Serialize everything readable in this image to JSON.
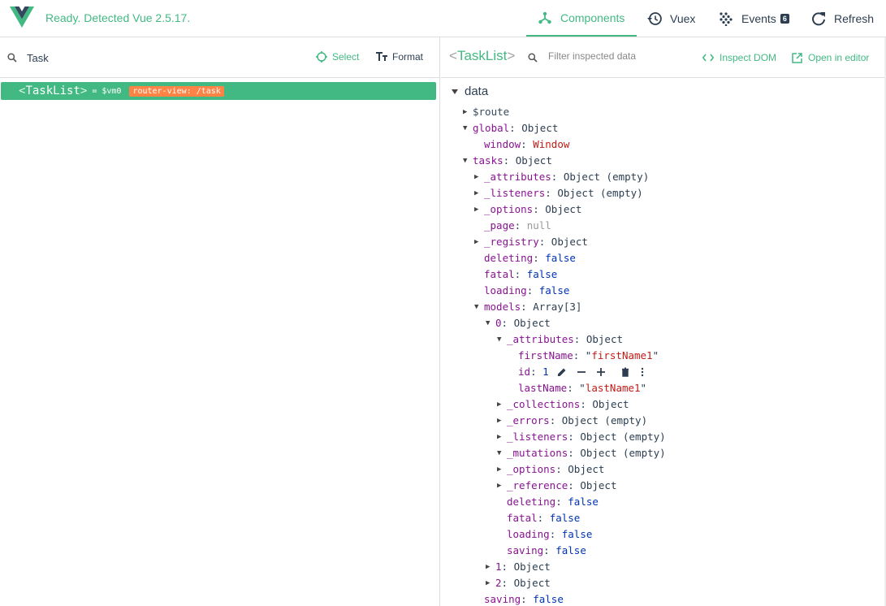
{
  "header": {
    "status": "Ready. Detected Vue 2.5.17.",
    "nav": [
      {
        "label": "Components",
        "icon": "components-icon",
        "active": true
      },
      {
        "label": "Vuex",
        "icon": "history-icon"
      },
      {
        "label": "Events",
        "icon": "events-icon",
        "badge": "6"
      },
      {
        "label": "Refresh",
        "icon": "refresh-icon"
      }
    ]
  },
  "left": {
    "search_value": "Task",
    "select_label": "Select",
    "format_label": "Format",
    "tree": {
      "open": "<",
      "name": "TaskList",
      "close": ">",
      "vm": "= $vm0",
      "route": "router-view: /task"
    }
  },
  "right": {
    "inspected": {
      "open": "<",
      "name": "TaskList",
      "close": ">"
    },
    "filter_placeholder": "Filter inspected data",
    "inspect_dom": "Inspect DOM",
    "open_editor": "Open in editor",
    "section": "data"
  },
  "colors": {
    "accent": "#42b983",
    "route_badge": "#ff8344",
    "key": "#881391",
    "boolean": "#0033b3",
    "string": "#c41a16"
  },
  "data_rows": [
    {
      "indent": 0,
      "tri": "right",
      "key": "$route",
      "plain": true
    },
    {
      "indent": 0,
      "tri": "down",
      "key": "global",
      "value": "Object",
      "vt": "type"
    },
    {
      "indent": 1,
      "key": "window",
      "value": "Window",
      "vt": "window"
    },
    {
      "indent": 0,
      "tri": "down",
      "key": "tasks",
      "value": "Object",
      "vt": "type"
    },
    {
      "indent": 1,
      "tri": "right",
      "key": "_attributes",
      "value": "Object (empty)",
      "vt": "type"
    },
    {
      "indent": 1,
      "tri": "right",
      "key": "_listeners",
      "value": "Object (empty)",
      "vt": "type"
    },
    {
      "indent": 1,
      "tri": "right",
      "key": "_options",
      "value": "Object",
      "vt": "type"
    },
    {
      "indent": 1,
      "key": "_page",
      "value": "null",
      "vt": "null"
    },
    {
      "indent": 1,
      "tri": "right",
      "key": "_registry",
      "value": "Object",
      "vt": "type"
    },
    {
      "indent": 1,
      "key": "deleting",
      "value": "false",
      "vt": "false"
    },
    {
      "indent": 1,
      "key": "fatal",
      "value": "false",
      "vt": "false"
    },
    {
      "indent": 1,
      "key": "loading",
      "value": "false",
      "vt": "false"
    },
    {
      "indent": 1,
      "tri": "down",
      "key": "models",
      "value": "Array[3]",
      "vt": "type"
    },
    {
      "indent": 2,
      "tri": "down",
      "key": "0",
      "value": "Object",
      "vt": "type"
    },
    {
      "indent": 3,
      "tri": "down",
      "key": "_attributes",
      "value": "Object",
      "vt": "type"
    },
    {
      "indent": 4,
      "key": "firstName",
      "value": "firstName1",
      "vt": "str"
    },
    {
      "indent": 4,
      "key": "id",
      "value": "1",
      "vt": "num",
      "actions": true
    },
    {
      "indent": 4,
      "key": "lastName",
      "value": "lastName1",
      "vt": "str"
    },
    {
      "indent": 3,
      "tri": "right",
      "key": "_collections",
      "value": "Object",
      "vt": "type"
    },
    {
      "indent": 3,
      "tri": "right",
      "key": "_errors",
      "value": "Object (empty)",
      "vt": "type"
    },
    {
      "indent": 3,
      "tri": "right",
      "key": "_listeners",
      "value": "Object (empty)",
      "vt": "type"
    },
    {
      "indent": 3,
      "tri": "down",
      "key": "_mutations",
      "value": "Object (empty)",
      "vt": "type"
    },
    {
      "indent": 3,
      "tri": "right",
      "key": "_options",
      "value": "Object",
      "vt": "type"
    },
    {
      "indent": 3,
      "tri": "right",
      "key": "_reference",
      "value": "Object",
      "vt": "type"
    },
    {
      "indent": 3,
      "key": "deleting",
      "value": "false",
      "vt": "false"
    },
    {
      "indent": 3,
      "key": "fatal",
      "value": "false",
      "vt": "false"
    },
    {
      "indent": 3,
      "key": "loading",
      "value": "false",
      "vt": "false"
    },
    {
      "indent": 3,
      "key": "saving",
      "value": "false",
      "vt": "false"
    },
    {
      "indent": 2,
      "tri": "right",
      "key": "1",
      "value": "Object",
      "vt": "type"
    },
    {
      "indent": 2,
      "tri": "right",
      "key": "2",
      "value": "Object",
      "vt": "type"
    },
    {
      "indent": 1,
      "key": "saving",
      "value": "false",
      "vt": "false"
    }
  ]
}
